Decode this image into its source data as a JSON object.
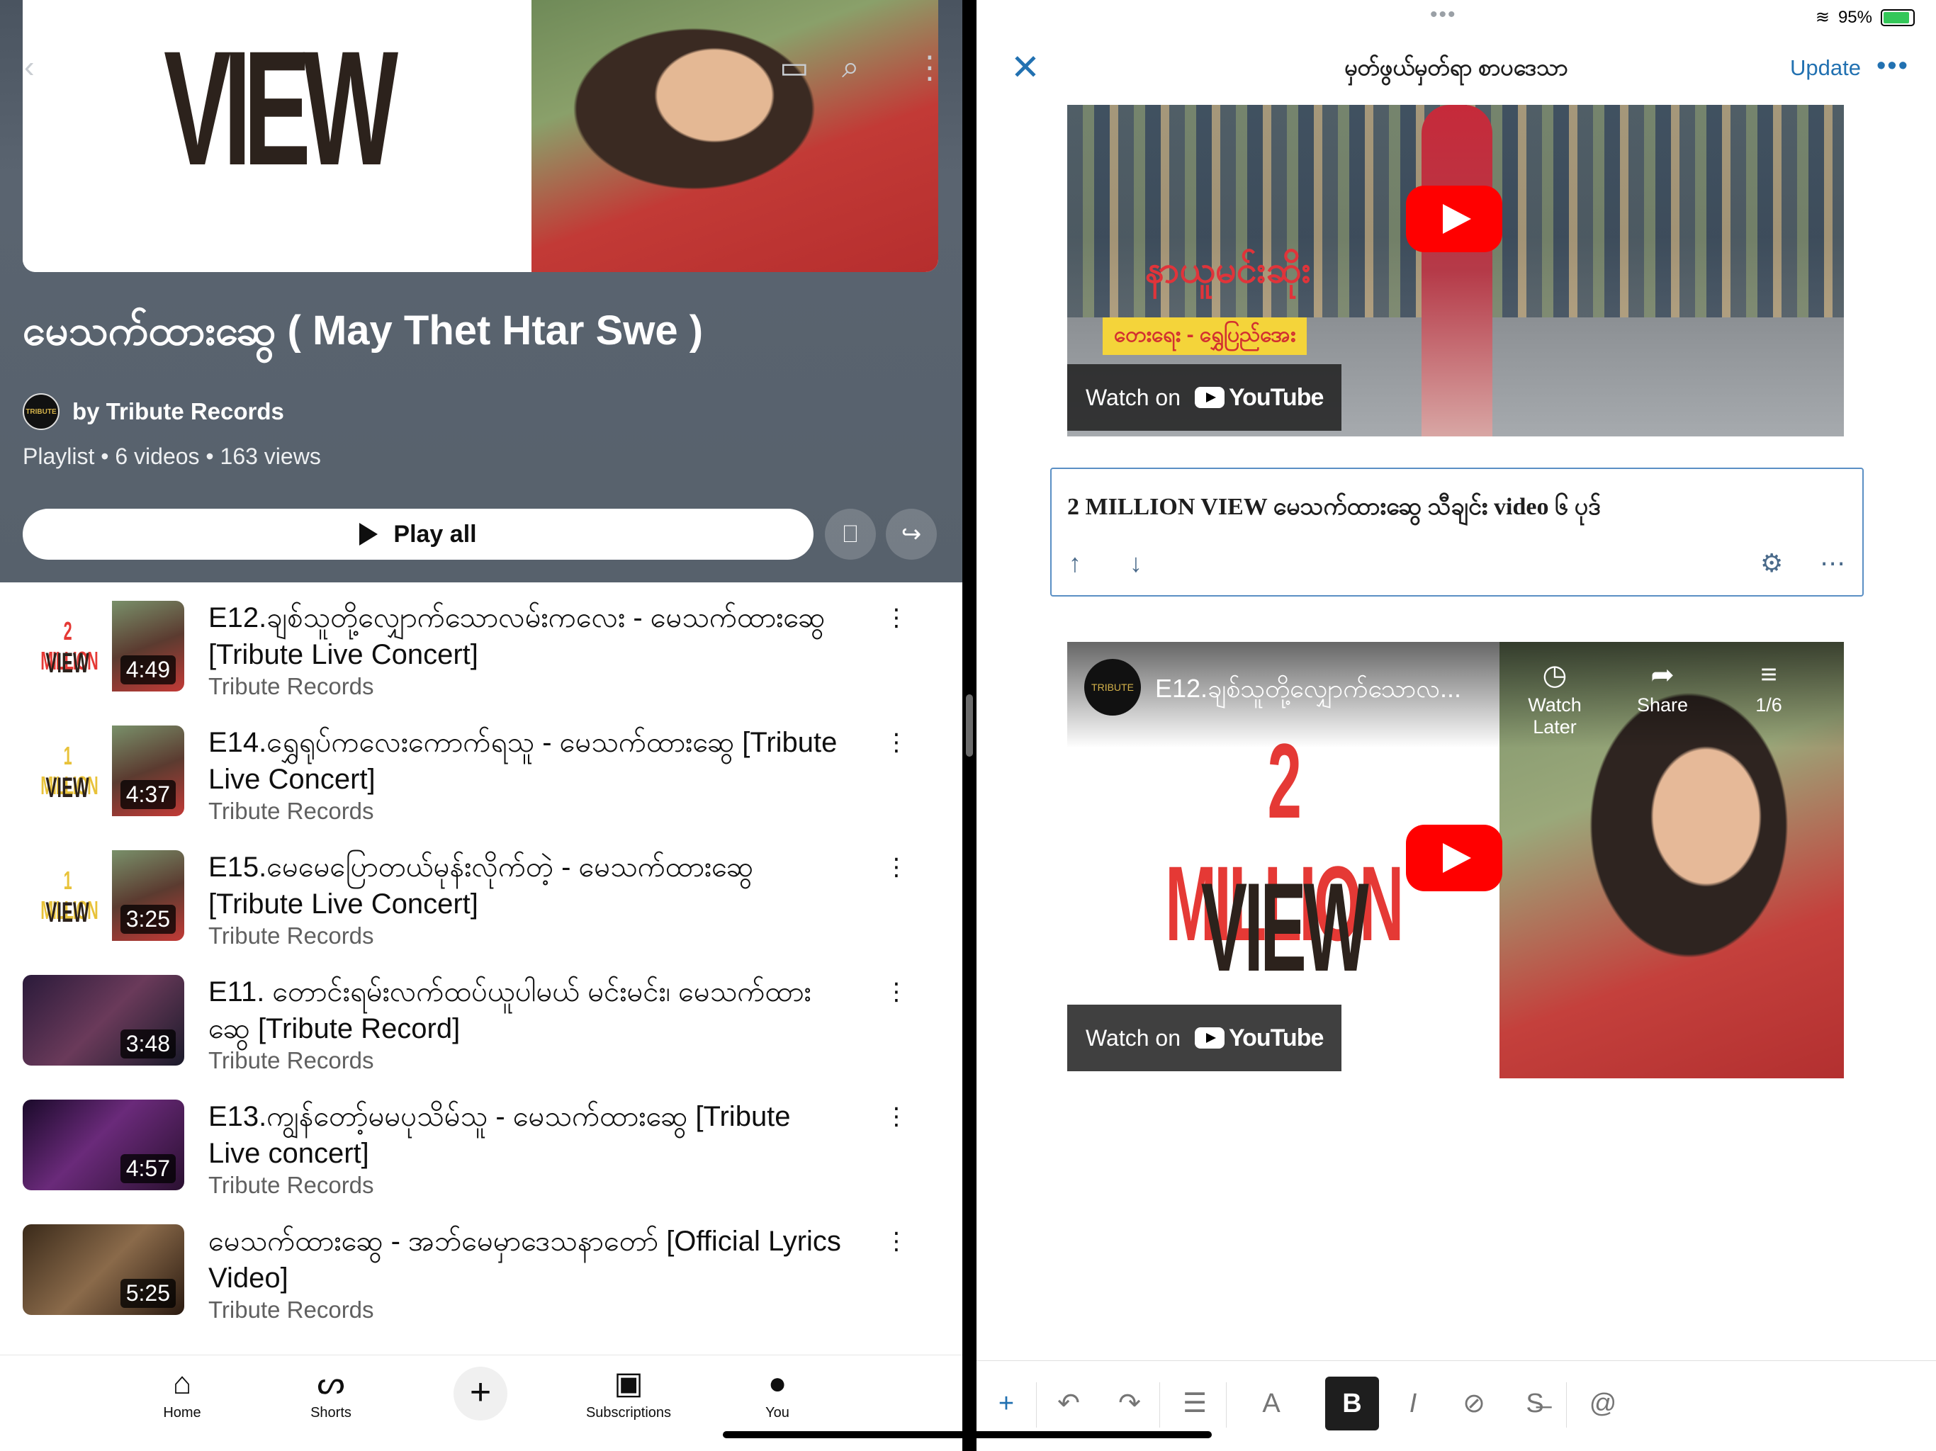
{
  "youtube": {
    "hero_text": "VIEW",
    "playlist_title": "မေသက်ထားဆွေ ( May Thet Htar Swe )",
    "owner": "by Tribute Records",
    "owner_avatar_text": "TRIBUTE",
    "meta": "Playlist • 6 videos • 163 views",
    "play_all": "Play all",
    "videos": [
      {
        "title": "E12.ချစ်သူတို့လျှောက်သောလမ်းကလေး - မေသက်ထားဆွေ [Tribute Live Concert]",
        "channel": "Tribute Records",
        "duration": "4:49",
        "badge_top": "2 MILLION",
        "badge_bottom": "VIEW"
      },
      {
        "title": "E14.ရွှေရုပ်ကလေးကောက်ရသူ - မေသက်ထားဆွေ [Tribute Live Concert]",
        "channel": "Tribute Records",
        "duration": "4:37",
        "badge_top": "1 MILLION",
        "badge_bottom": "VIEW"
      },
      {
        "title": "E15.မေမေပြောတယ်မုန်းလိုက်တဲ့ - မေသက်ထားဆွေ [Tribute Live Concert]",
        "channel": "Tribute Records",
        "duration": "3:25",
        "badge_top": "1 MILLION",
        "badge_bottom": "VIEW"
      },
      {
        "title": "E11. တောင်းရမ်းလက်ထပ်ယူပါမယ် မင်းမင်း၊ မေသက်ထားဆွေ [Tribute Record]",
        "channel": "Tribute Records",
        "duration": "3:48"
      },
      {
        "title": "E13.ကျွန်တော့်မမပုသိမ်သူ - မေသက်ထားဆွေ [Tribute Live concert]",
        "channel": "Tribute Records",
        "duration": "4:57"
      },
      {
        "title": "မေသက်ထားဆွေ - အဘ်မေမှာဒေသနာတော် [Official Lyrics Video]",
        "channel": "Tribute Records",
        "duration": "5:25"
      }
    ],
    "nav": [
      "Home",
      "Shorts",
      "Subscriptions",
      "You"
    ]
  },
  "editor": {
    "battery": "95%",
    "title": "မှတ်ဖွယ်မှတ်ရာ စာပဒေသာ",
    "update": "Update",
    "video1": {
      "caption1": "နာယူမင်းဆိုး",
      "caption2": "တေးရေး - ရွှေပြည်အေး",
      "watch_on": "Watch on",
      "youtube": "YouTube"
    },
    "block_text": "2 MILLION VIEW မေသက်ထားဆွေ သီချင်း video ၆ ပုဒ်",
    "video2": {
      "channel_avatar": "TRIBUTE",
      "title": "E12.ချစ်သူတို့လျှောက်သောလ...",
      "big_top": "2 MILLION",
      "big_bottom": "VIEW",
      "watch_later": "Watch Later",
      "share": "Share",
      "count": "1/6",
      "watch_on": "Watch on",
      "youtube": "YouTube"
    },
    "toolbar_icons": [
      "add-block",
      "undo",
      "redo",
      "list-view",
      "text-color",
      "bold",
      "italic",
      "link",
      "strikethrough",
      "mention"
    ],
    "toolbar_glyphs": {
      "add": "+",
      "undo": "↶",
      "redo": "↷",
      "list": "☰",
      "color": "A",
      "bold": "B",
      "italic": "I",
      "link": "⊘",
      "strike": "S̶",
      "mention": "@"
    },
    "accent": "#2271b1"
  }
}
